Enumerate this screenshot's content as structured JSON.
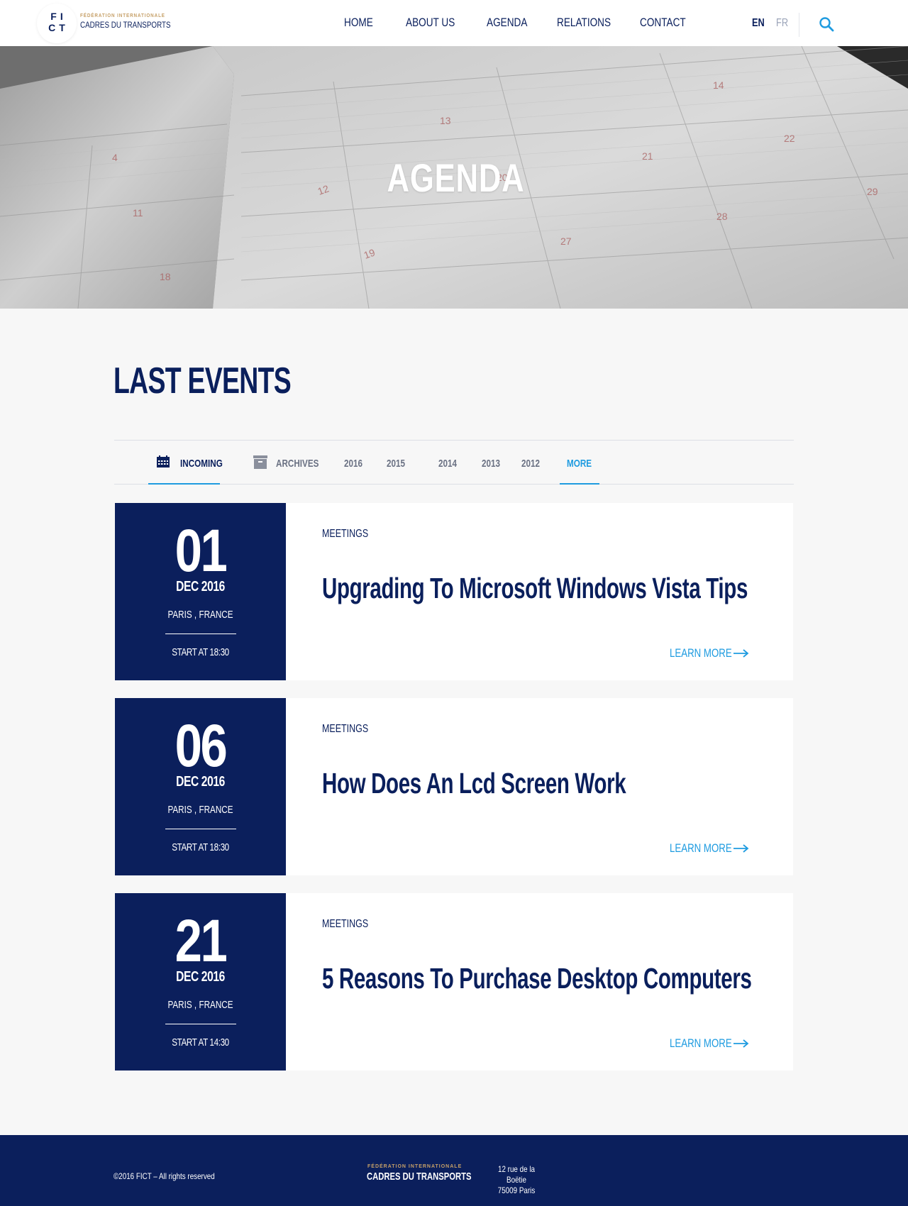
{
  "header": {
    "logo_mark_line1": "FI",
    "logo_mark_line2": "CT",
    "logo_subtitle": "FÉDÉRATION INTERNATIONALE",
    "logo_title": "CADRES DU TRANSPORTS",
    "nav": [
      {
        "label": "HOME"
      },
      {
        "label": "ABOUT US"
      },
      {
        "label": "AGENDA"
      },
      {
        "label": "RELATIONS"
      },
      {
        "label": "CONTACT"
      }
    ],
    "languages": [
      "EN",
      "FR"
    ],
    "active_language": "EN",
    "search_icon": "search-icon"
  },
  "hero": {
    "title": "AGENDA",
    "calendar_numbers": [
      "4",
      "11",
      "18",
      "12",
      "19",
      "13",
      "20",
      "21",
      "27",
      "28",
      "22",
      "29",
      "14"
    ]
  },
  "section": {
    "title": "LAST EVENTS"
  },
  "tabs": [
    {
      "label": "INCOMING",
      "icon": "calendar-icon",
      "active": true
    },
    {
      "label": "ARCHIVES",
      "icon": "archive-box-icon"
    },
    {
      "label": "2016"
    },
    {
      "label": "2015"
    },
    {
      "label": "2014"
    },
    {
      "label": "2013"
    },
    {
      "label": "2012"
    },
    {
      "label": "MORE"
    }
  ],
  "events": [
    {
      "day": "01",
      "month": "DEC 2016",
      "place": "PARIS , FRANCE",
      "start": "START AT 18:30",
      "category": "MEETINGS",
      "title": "Upgrading To Microsoft Windows Vista Tips",
      "cta": "LEARN MORE"
    },
    {
      "day": "06",
      "month": "DEC 2016",
      "place": "PARIS , FRANCE",
      "start": "START AT 18:30",
      "category": "MEETINGS",
      "title": "How Does An Lcd Screen Work",
      "cta": "LEARN MORE"
    },
    {
      "day": "21",
      "month": "DEC 2016",
      "place": "PARIS , FRANCE",
      "start": "START AT 14:30",
      "category": "MEETINGS",
      "title": "5 Reasons To Purchase Desktop Computers",
      "cta": "LEARN MORE"
    }
  ],
  "footer": {
    "copyright": "©2016 FICT – All rights reserved",
    "logo_subtitle": "FÉDÉRATION INTERNATIONALE",
    "logo_title": "CADRES DU TRANSPORTS",
    "address_line1": "12 rue de la Boëtie",
    "address_line2": "75009 Paris"
  },
  "colors": {
    "navy": "#0b1f5c",
    "accent": "#1e9be0",
    "gold": "#c6a068",
    "background": "#f7f7f7"
  }
}
